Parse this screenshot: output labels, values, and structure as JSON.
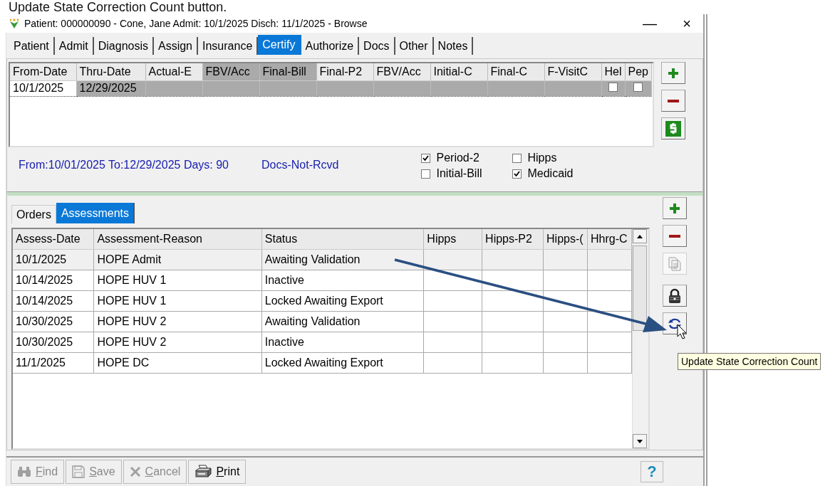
{
  "caption": "Update State Correction  Count button.",
  "window": {
    "title": "Patient: 000000090 - Cone, Jane   Admit: 10/1/2025   Disch: 11/1/2025 - Browse",
    "minimize": "—",
    "close": "×"
  },
  "tabs": [
    {
      "label": "Patient",
      "selected": false
    },
    {
      "label": "Admit",
      "selected": false
    },
    {
      "label": "Diagnosis",
      "selected": false
    },
    {
      "label": "Assign",
      "selected": false
    },
    {
      "label": "Insurance",
      "selected": false
    },
    {
      "label": "Certify",
      "selected": true
    },
    {
      "label": "Authorize",
      "selected": false
    },
    {
      "label": "Docs",
      "selected": false
    },
    {
      "label": "Other",
      "selected": false
    },
    {
      "label": "Notes",
      "selected": false
    }
  ],
  "cert_table": {
    "columns": [
      {
        "label": "From-Date",
        "highlighted": false
      },
      {
        "label": "Thru-Date",
        "highlighted": false
      },
      {
        "label": "Actual-E",
        "highlighted": false
      },
      {
        "label": "FBV/Acc",
        "highlighted": true
      },
      {
        "label": "Final-Bill",
        "highlighted": true
      },
      {
        "label": "Final-P2",
        "highlighted": false
      },
      {
        "label": "FBV/Acc",
        "highlighted": false
      },
      {
        "label": "Initial-C",
        "highlighted": false
      },
      {
        "label": "Final-C",
        "highlighted": false
      },
      {
        "label": "F-VisitC",
        "highlighted": false
      },
      {
        "label": "Hel",
        "highlighted": false
      },
      {
        "label": "Pep",
        "highlighted": false
      }
    ],
    "rows": [
      {
        "selected": true,
        "first_cell_focused": true,
        "cells": [
          "10/1/2025",
          "12/29/2025",
          "",
          "",
          "",
          "",
          "",
          "",
          "",
          ""
        ],
        "checks": [
          false,
          false
        ]
      }
    ]
  },
  "cert_buttons": [
    {
      "kind": "add",
      "disabled": false
    },
    {
      "kind": "remove",
      "disabled": false
    },
    {
      "kind": "dollar",
      "disabled": false
    }
  ],
  "summary": {
    "texts": [
      "From:10/01/2025  To:12/29/2025  Days: 90",
      "Docs-Not-Rcvd"
    ],
    "options": [
      {
        "label": "Period-2",
        "checked": true
      },
      {
        "label": "Hipps",
        "checked": false
      },
      {
        "label": "Initial-Bill",
        "checked": false
      },
      {
        "label": "Medicaid",
        "checked": true
      }
    ]
  },
  "subtabs": [
    {
      "label": "Orders",
      "selected": false
    },
    {
      "label": "Assessments",
      "selected": true
    }
  ],
  "assessments": {
    "columns": [
      "Assess-Date",
      "Assessment-Reason",
      "Status",
      "Hipps",
      "Hipps-P2",
      "Hipps-(",
      "Hhrg-C"
    ],
    "rows": [
      {
        "selected": true,
        "cells": [
          "10/1/2025",
          "HOPE Admit",
          "Awaiting Validation",
          "",
          "",
          "",
          ""
        ]
      },
      {
        "selected": false,
        "cells": [
          "10/14/2025",
          "HOPE HUV 1",
          "Inactive",
          "",
          "",
          "",
          ""
        ]
      },
      {
        "selected": false,
        "cells": [
          "10/14/2025",
          "HOPE HUV 1",
          "Locked Awaiting Export",
          "",
          "",
          "",
          ""
        ]
      },
      {
        "selected": false,
        "cells": [
          "10/30/2025",
          "HOPE HUV 2",
          "Awaiting Validation",
          "",
          "",
          "",
          ""
        ]
      },
      {
        "selected": false,
        "cells": [
          "10/30/2025",
          "HOPE HUV 2",
          "Inactive",
          "",
          "",
          "",
          ""
        ]
      },
      {
        "selected": false,
        "cells": [
          "11/1/2025",
          "HOPE DC",
          "Locked Awaiting Export",
          "",
          "",
          "",
          ""
        ]
      }
    ]
  },
  "assessment_buttons": [
    {
      "kind": "add",
      "disabled": false
    },
    {
      "kind": "remove",
      "disabled": false
    },
    {
      "kind": "copy",
      "disabled": true
    },
    {
      "kind": "lock",
      "disabled": false
    },
    {
      "kind": "refresh",
      "disabled": false
    }
  ],
  "tooltip": "Update State Correction Count",
  "footer_buttons": [
    {
      "label": "Find",
      "kind": "find",
      "disabled": true
    },
    {
      "label": "Save",
      "kind": "save",
      "disabled": true
    },
    {
      "label": "Cancel",
      "kind": "cancel",
      "disabled": true
    },
    {
      "label": "Print",
      "kind": "print",
      "disabled": false
    }
  ],
  "help": "?"
}
